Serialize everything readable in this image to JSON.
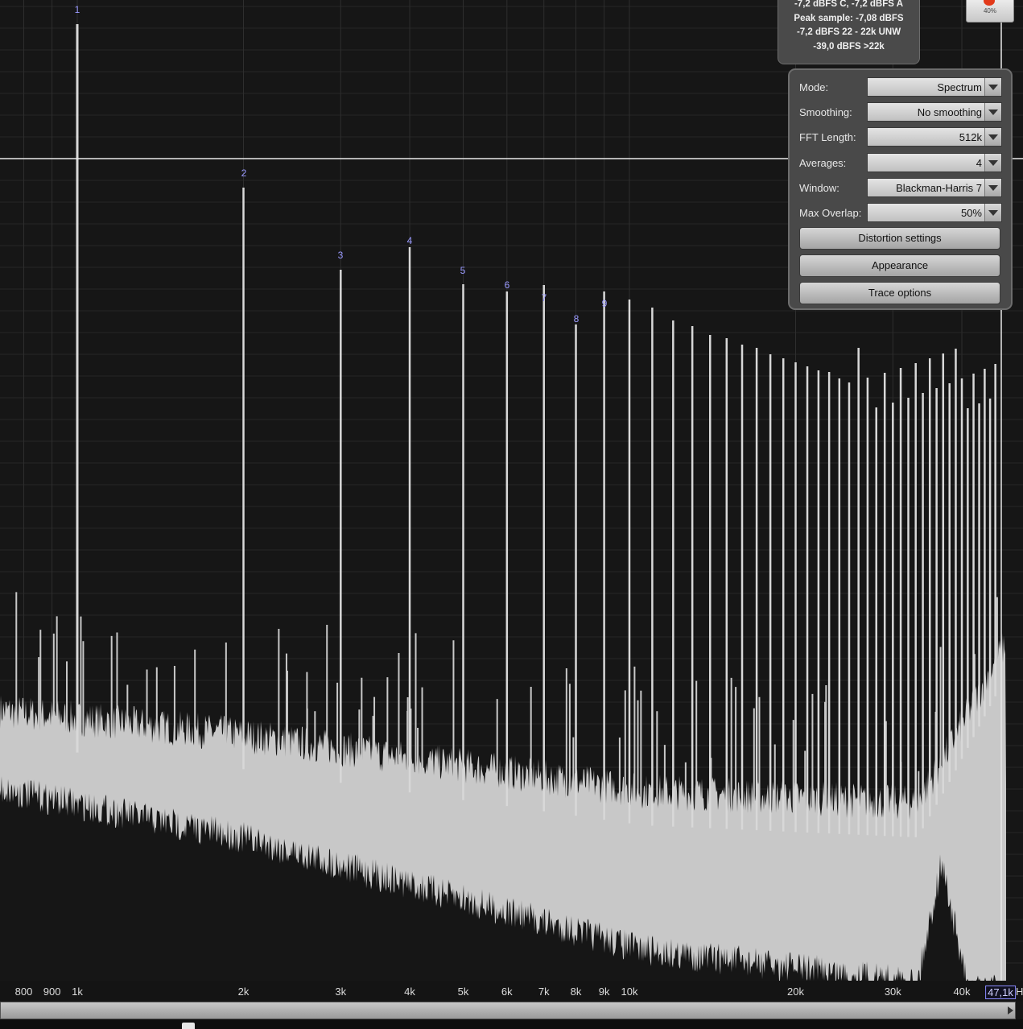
{
  "info_panel": {
    "lines": [
      "-7,2 dBFS C, -7,2 dBFS A",
      "Peak sample: -7,08 dBFS",
      "-7,2 dBFS 22 - 22k UNW",
      "-39,0 dBFS >22k"
    ]
  },
  "record_button": {
    "label": "40%"
  },
  "settings": {
    "mode": {
      "label": "Mode:",
      "value": "Spectrum"
    },
    "smoothing": {
      "label": "Smoothing:",
      "value": "No  smoothing"
    },
    "fft_length": {
      "label": "FFT Length:",
      "value": "512k"
    },
    "averages": {
      "label": "Averages:",
      "value": "4"
    },
    "window": {
      "label": "Window:",
      "value": "Blackman-Harris 7"
    },
    "max_overlap": {
      "label": "Max Overlap:",
      "value": "50%"
    },
    "distortion_button": "Distortion settings",
    "appearance_button": "Appearance",
    "trace_button": "Trace options"
  },
  "x_axis": {
    "ticks": [
      "800",
      "900",
      "1k",
      "2k",
      "3k",
      "4k",
      "5k",
      "6k",
      "7k",
      "8k",
      "9k",
      "10k",
      "20k",
      "30k",
      "40k"
    ],
    "current_readout": "47,1k",
    "unit": "H"
  },
  "harmonic_markers": [
    "1",
    "2",
    "3",
    "4",
    "5",
    "6",
    "7",
    "8",
    "9"
  ],
  "colors": {
    "background": "#161616",
    "trace": "#c8c8c8",
    "marker_text": "#9a9aff",
    "panel": "#494949"
  },
  "chart_data": {
    "type": "line",
    "title": "",
    "xlabel": "",
    "ylabel": "",
    "x_scale": "log",
    "xlim": [
      700,
      47100
    ],
    "grid": true,
    "fundamental_hz": 1000,
    "harmonics": [
      {
        "marker": "1",
        "freq": 1000
      },
      {
        "marker": "2",
        "freq": 2000
      },
      {
        "marker": "3",
        "freq": 3000
      },
      {
        "marker": "4",
        "freq": 4000
      },
      {
        "marker": "5",
        "freq": 5000
      },
      {
        "marker": "6",
        "freq": 6000
      },
      {
        "marker": "7",
        "freq": 7000
      },
      {
        "marker": "8",
        "freq": 8000
      },
      {
        "marker": "9",
        "freq": 9000
      }
    ]
  }
}
